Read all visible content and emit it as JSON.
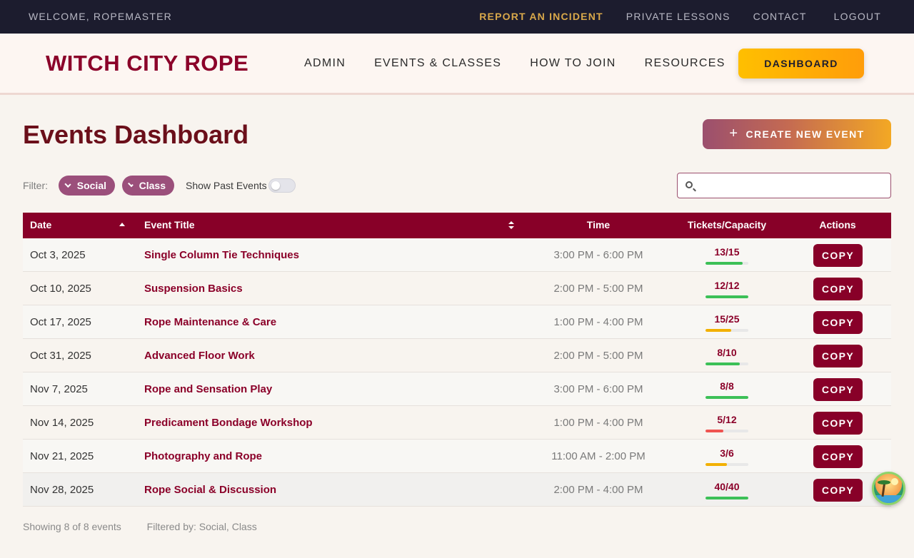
{
  "topbar": {
    "welcome": "WELCOME, ROPEMASTER",
    "links": [
      "REPORT AN INCIDENT",
      "PRIVATE LESSONS",
      "CONTACT",
      "LOGOUT"
    ]
  },
  "header": {
    "logo": "WITCH CITY ROPE",
    "nav": [
      "ADMIN",
      "EVENTS & CLASSES",
      "HOW TO JOIN",
      "RESOURCES"
    ],
    "dashboard_button": "DASHBOARD"
  },
  "page": {
    "title": "Events Dashboard",
    "create_button": "CREATE NEW EVENT"
  },
  "filters": {
    "label": "Filter:",
    "chips": [
      "Social",
      "Class"
    ],
    "show_past_label": "Show Past Events",
    "show_past_enabled": false,
    "search_value": "",
    "search_placeholder": ""
  },
  "table": {
    "headers": {
      "date": "Date",
      "title": "Event Title",
      "time": "Time",
      "tickets": "Tickets/Capacity",
      "actions": "Actions"
    },
    "copy_label": "COPY",
    "rows": [
      {
        "date": "Oct 3, 2025",
        "title": "Single Column Tie Techniques",
        "time": "3:00 PM - 6:00 PM",
        "tickets": "13/15",
        "sold": 13,
        "capacity": 15,
        "bar_color": "#3cc057"
      },
      {
        "date": "Oct 10, 2025",
        "title": "Suspension Basics",
        "time": "2:00 PM - 5:00 PM",
        "tickets": "12/12",
        "sold": 12,
        "capacity": 12,
        "bar_color": "#3cc057"
      },
      {
        "date": "Oct 17, 2025",
        "title": "Rope Maintenance & Care",
        "time": "1:00 PM - 4:00 PM",
        "tickets": "15/25",
        "sold": 15,
        "capacity": 25,
        "bar_color": "#f2b000"
      },
      {
        "date": "Oct 31, 2025",
        "title": "Advanced Floor Work",
        "time": "2:00 PM - 5:00 PM",
        "tickets": "8/10",
        "sold": 8,
        "capacity": 10,
        "bar_color": "#3cc057"
      },
      {
        "date": "Nov 7, 2025",
        "title": "Rope and Sensation Play",
        "time": "3:00 PM - 6:00 PM",
        "tickets": "8/8",
        "sold": 8,
        "capacity": 8,
        "bar_color": "#3cc057"
      },
      {
        "date": "Nov 14, 2025",
        "title": "Predicament Bondage Workshop",
        "time": "1:00 PM - 4:00 PM",
        "tickets": "5/12",
        "sold": 5,
        "capacity": 12,
        "bar_color": "#ef5350"
      },
      {
        "date": "Nov 21, 2025",
        "title": "Photography and Rope",
        "time": "11:00 AM - 2:00 PM",
        "tickets": "3/6",
        "sold": 3,
        "capacity": 6,
        "bar_color": "#f2b000"
      },
      {
        "date": "Nov 28, 2025",
        "title": "Rope Social & Discussion",
        "time": "2:00 PM - 4:00 PM",
        "tickets": "40/40",
        "sold": 40,
        "capacity": 40,
        "bar_color": "#3cc057"
      }
    ]
  },
  "footer": {
    "showing": "Showing 8 of 8 events",
    "filtered": "Filtered by: Social, Class"
  },
  "colors": {
    "brand": "#880028",
    "accent": "#ffbf00",
    "topbar": "#1c1c2e"
  }
}
